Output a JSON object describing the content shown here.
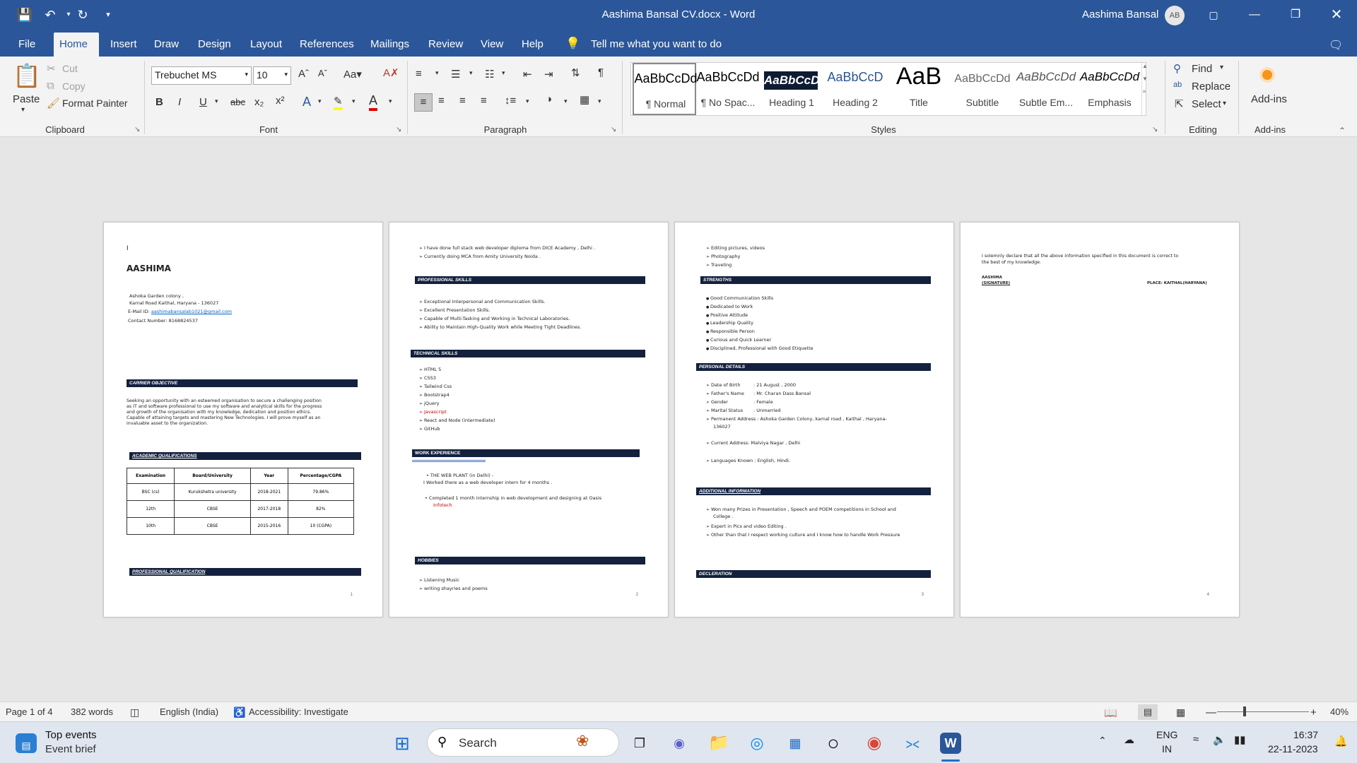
{
  "window": {
    "title": "Aashima Bansal CV.docx  -  Word",
    "user_name": "Aashima Bansal",
    "user_initials": "AB"
  },
  "tabs": [
    "File",
    "Home",
    "Insert",
    "Draw",
    "Design",
    "Layout",
    "References",
    "Mailings",
    "Review",
    "View",
    "Help"
  ],
  "active_tab": "Home",
  "tell_me": "Tell me what you want to do",
  "clipboard": {
    "paste": "Paste",
    "cut": "Cut",
    "copy": "Copy",
    "format_painter": "Format Painter",
    "label": "Clipboard"
  },
  "font": {
    "name": "Trebuchet MS",
    "size": "10",
    "label": "Font"
  },
  "paragraph": {
    "label": "Paragraph"
  },
  "styles": {
    "label": "Styles",
    "items": [
      {
        "preview": "AaBbCcDd",
        "name": "¶ Normal"
      },
      {
        "preview": "AaBbCcDd",
        "name": "¶ No Spac..."
      },
      {
        "preview": "AaBbCcD",
        "name": "Heading 1"
      },
      {
        "preview": "AaBbCcD",
        "name": "Heading 2"
      },
      {
        "preview": "AaB",
        "name": "Title"
      },
      {
        "preview": "AaBbCcDd",
        "name": "Subtitle"
      },
      {
        "preview": "AaBbCcDd",
        "name": "Subtle Em..."
      },
      {
        "preview": "AaBbCcDd",
        "name": "Emphasis"
      }
    ]
  },
  "editing": {
    "find": "Find",
    "replace": "Replace",
    "select": "Select",
    "label": "Editing"
  },
  "addins": {
    "button": "Add-ins",
    "label": "Add-ins"
  },
  "page1": {
    "cursor": "I",
    "name": "AASHIMA",
    "address1": "Ashoka Garden colony ,",
    "address2": "Karnal Road Kaithal, Haryana - 136027",
    "email_label": "E-Mail ID: ",
    "email": "aashimabansalab1021@gmail.com",
    "contact": "Contact Number: 8168824537",
    "objective_title": "CARRIER OBJECTIVE",
    "objective_lines": [
      "Seeking an opportunity with an esteemed organisation to secure a challenging position",
      "as IT and software professional to use my software and analytical skills for the progress",
      "and growth of the organisation with my knowledge, dedication and position ethics.",
      "Capable of attaining targets and mastering New Technologies. I will prove myself as an",
      "invaluable asset to the organization."
    ],
    "academic_title": "ACADEMIC  QUALIFICATIONS",
    "table_headers": [
      "Examination",
      "Board/University",
      "Year",
      "Percentage/CGPA"
    ],
    "table_rows": [
      [
        "BSC (cs)",
        "Kurukshetra university",
        "2018-2021",
        "79.86%"
      ],
      [
        "12th",
        "CBSE",
        "2017-2018",
        "82%"
      ],
      [
        "10th",
        "CBSE",
        "2015-2016",
        "10 (CGPA)"
      ]
    ],
    "professional_title": "PROFESSIONAL  QUALIFICATION",
    "page_number": "1"
  },
  "page2": {
    "top_items": [
      "I have done full stack web developer diploma from DICE Academy , Delhi .",
      "Currently doing MCA from Amity University Noida ."
    ],
    "skills_title": "PROFESSIONAL SKILLS",
    "skills": [
      "Exceptional Interpersonal and Communication Skills.",
      "Excellent Presentation Skills.",
      "Capable of Multi-Tasking and Working in Technical Laboratories.",
      "Ability to Maintain High-Quality Work while Meeting Tight Deadlines."
    ],
    "tech_title": "TECHNICAL SKILLS",
    "tech": [
      "HTML 5",
      "CSS3",
      "Tailwind Css",
      "Bootstrap4",
      "jQuery",
      "Javascript",
      "React and Node (intermediate)",
      "GitHub"
    ],
    "work_title": "WORK EXPERIENCE",
    "work_line1": "• THE WEB PLANT  (in Delhi)  -",
    "work_line2": "I Worked there as a web developer intern for 4 months .",
    "work_line3": "• Completed 1 month internship in web development and designing at Oasis",
    "work_line4": "Infotech",
    "hobbies_title": "HOBBIES",
    "hobbies": [
      "Listening Music",
      "writing shayries and poems"
    ],
    "page_number": "2"
  },
  "page3": {
    "hobbies_cont": [
      "Editing pictures, videos",
      "Photography",
      "Traveling"
    ],
    "strengths_title": "STRENGTHS",
    "strengths": [
      "Good Communication Skills",
      "Dedicated to Work",
      "Positive Attitude",
      "Leadership Quality",
      "Responsible Person",
      "Curious and Quick Learner",
      "Disciplined, Professional with Good Etiquette"
    ],
    "personal_title": "PERSONAL DETAILS",
    "personal": [
      {
        "label": "Date of Birth",
        "value": "21 August , 2000"
      },
      {
        "label": "Father's Name",
        "value": "Mr. Charan Dass Bansal"
      },
      {
        "label": "Gender",
        "value": "Female"
      },
      {
        "label": "Marital Status",
        "value": "Unmarried"
      }
    ],
    "permanent_line1": "Permanent Address :  Ashoka Garden Colony, karnal road , Kaithal , Haryana-",
    "permanent_line2": "136027",
    "current_address": "Current Address: Malviya Nagar , Delhi",
    "languages": "Languages Known  :  English, Hindi.",
    "additional_title": "ADDITIONAL  INFORMATION",
    "additional": [
      "Won many Prizes in Presentation , Speech and POEM competitions in School and",
      "College .",
      "Expert in Pics and video Editing .",
      "Other than that I respect working culture and I know how to handle Work Pressure"
    ],
    "declaration_title": "DECLERATION",
    "page_number": "3"
  },
  "page4": {
    "decl_line1": "I solemnly declare that all the above information specified in this document is correct to",
    "decl_line2": "the best of my knowledge.",
    "name": "AASHIMA",
    "signature": "(SIGNATURE)",
    "place": "PLACE: KAITHAL(HARYANA)",
    "page_number": "4"
  },
  "status": {
    "page": "Page 1 of 4",
    "words": "382 words",
    "language": "English (India)",
    "accessibility": "Accessibility: Investigate",
    "zoom": "40%",
    "zoom_value": 0.4
  },
  "taskbar": {
    "widget_title": "Top events",
    "widget_sub": "Event brief",
    "search": "Search",
    "lang1": "ENG",
    "lang2": "IN",
    "time": "16:37",
    "date": "22-11-2023"
  }
}
